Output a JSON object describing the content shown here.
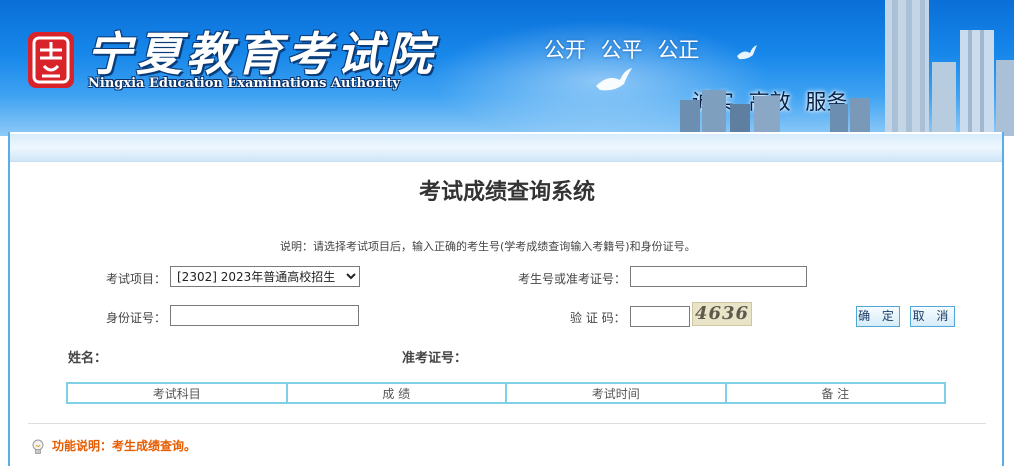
{
  "header": {
    "title_cn": "宁夏教育考试院",
    "title_en": "Ningxia Education Examinations Authority",
    "slogan_line1": "公开  公平  公正",
    "slogan_line2": "诚实  高效  服务",
    "logo_icon": "seal-logo-icon"
  },
  "page": {
    "title": "考试成绩查询系统",
    "note": "说明：请选择考试项目后，输入正确的考生号(学考成绩查询输入考籍号)和身份证号。"
  },
  "form": {
    "exam_label": "考试项目：",
    "exam_selected": "[2302] 2023年普通高校招生",
    "exam_options": [
      "[2302] 2023年普通高校招生"
    ],
    "candidate_label": "考生号或准考证号：",
    "candidate_value": "",
    "id_label": "身份证号：",
    "id_value": "",
    "captcha_label": "验 证 码：",
    "captcha_value": "",
    "captcha_text": "4636",
    "confirm_button": "确 定",
    "cancel_button": "取 消"
  },
  "info": {
    "name_label": "姓名：",
    "ticket_label": "准考证号："
  },
  "results": {
    "columns": [
      "考试科目",
      "成 绩",
      "考试时间",
      "备 注"
    ],
    "rows": []
  },
  "footer": {
    "function_note": "功能说明：考生成绩查询。",
    "icon": "lightbulb-icon"
  },
  "colors": {
    "banner_blue": "#1787ea",
    "table_border": "#7fd0e6",
    "accent_orange": "#e65c00"
  }
}
